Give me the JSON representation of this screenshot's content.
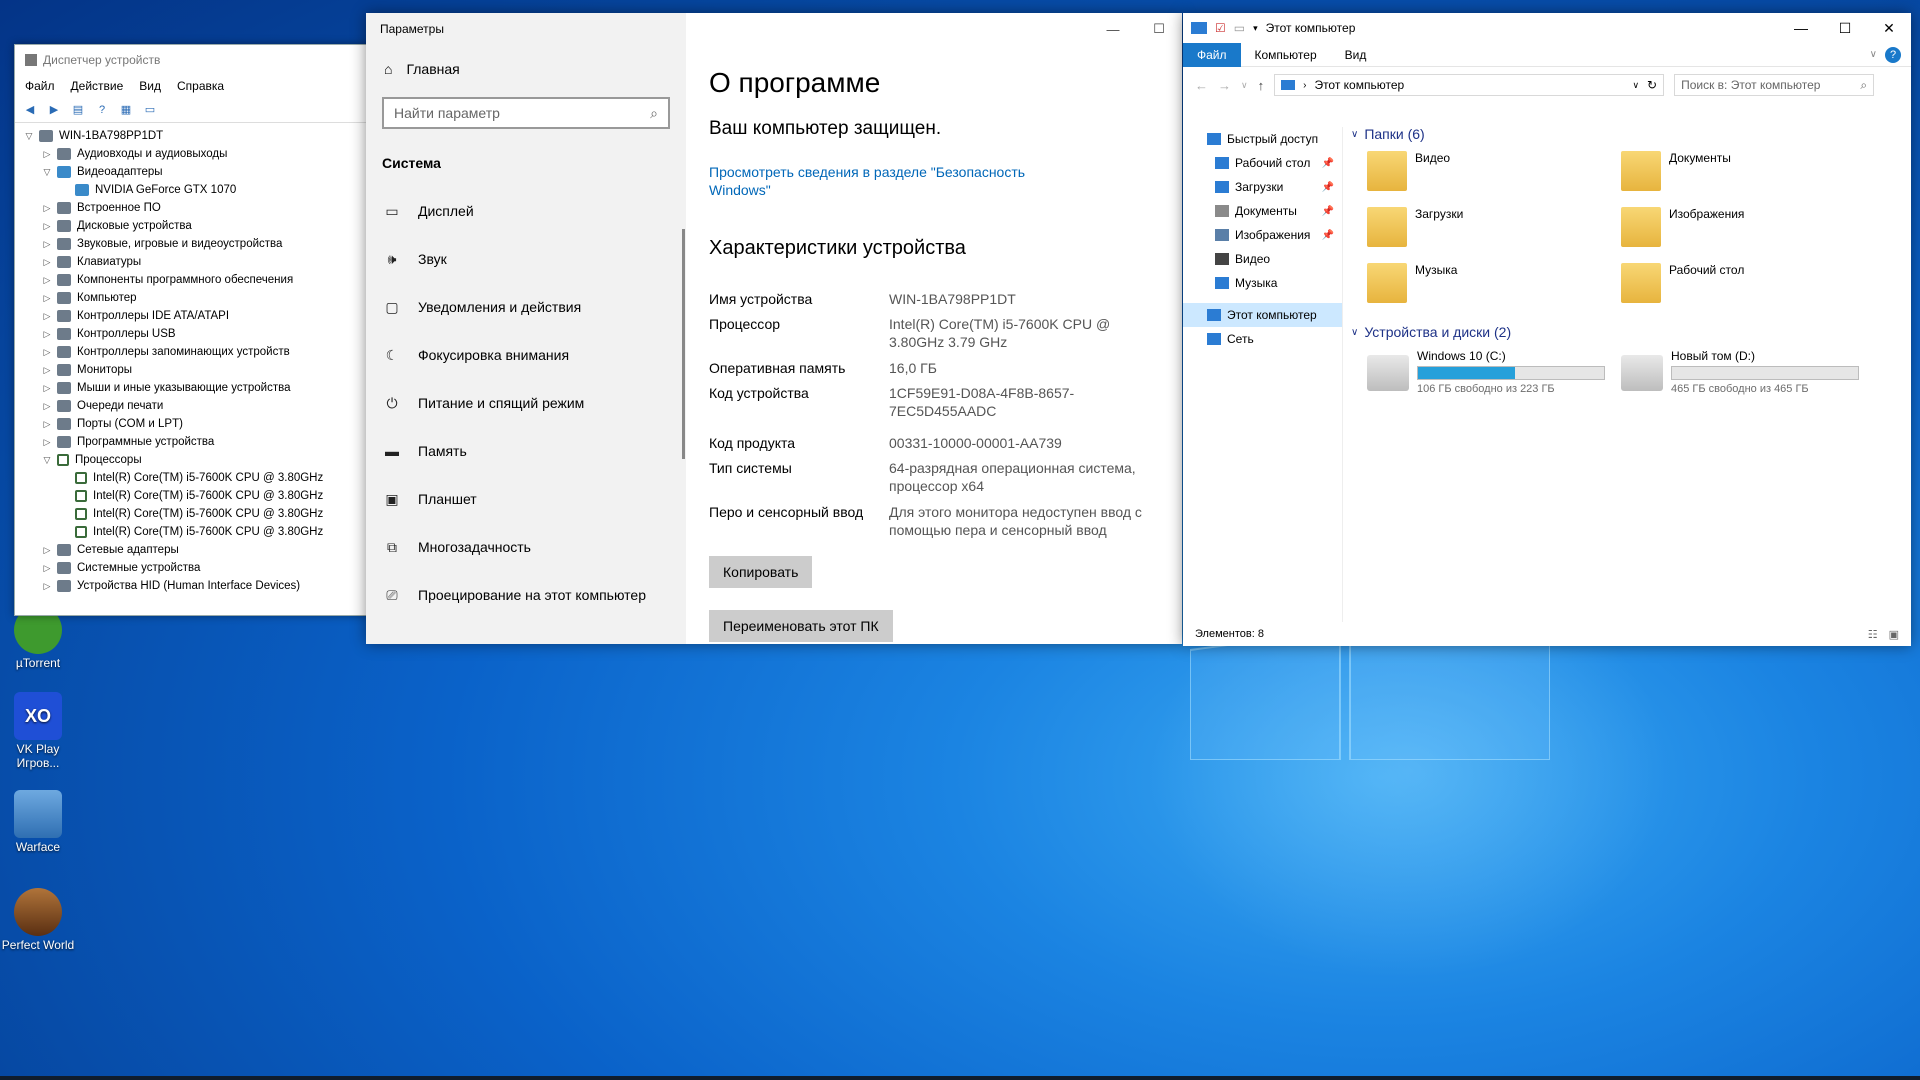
{
  "desktop": {
    "icons": [
      {
        "label": "µTorrent"
      },
      {
        "label": "VK Play Игров..."
      },
      {
        "label": "Warface"
      },
      {
        "label": "Perfect World"
      }
    ]
  },
  "device_manager": {
    "title": "Диспетчер устройств",
    "menu": [
      "Файл",
      "Действие",
      "Вид",
      "Справка"
    ],
    "tree": [
      {
        "label": "WIN-1BA798PP1DT",
        "level": 0,
        "expand": "down",
        "icon": "computer"
      },
      {
        "label": "Аудиовходы и аудиовыходы",
        "level": 1,
        "expand": "right",
        "icon": "audio"
      },
      {
        "label": "Видеоадаптеры",
        "level": 1,
        "expand": "down",
        "icon": "display"
      },
      {
        "label": "NVIDIA GeForce GTX 1070",
        "level": 2,
        "expand": "",
        "icon": "gpu"
      },
      {
        "label": "Встроенное ПО",
        "level": 1,
        "expand": "right",
        "icon": "firmware"
      },
      {
        "label": "Дисковые устройства",
        "level": 1,
        "expand": "right",
        "icon": "disk"
      },
      {
        "label": "Звуковые, игровые и видеоустройства",
        "level": 1,
        "expand": "right",
        "icon": "sound"
      },
      {
        "label": "Клавиатуры",
        "level": 1,
        "expand": "right",
        "icon": "keyboard"
      },
      {
        "label": "Компоненты программного обеспечения",
        "level": 1,
        "expand": "right",
        "icon": "software"
      },
      {
        "label": "Компьютер",
        "level": 1,
        "expand": "right",
        "icon": "computer"
      },
      {
        "label": "Контроллеры IDE ATA/ATAPI",
        "level": 1,
        "expand": "right",
        "icon": "ide"
      },
      {
        "label": "Контроллеры USB",
        "level": 1,
        "expand": "right",
        "icon": "usb"
      },
      {
        "label": "Контроллеры запоминающих устройств",
        "level": 1,
        "expand": "right",
        "icon": "storage"
      },
      {
        "label": "Мониторы",
        "level": 1,
        "expand": "right",
        "icon": "monitor"
      },
      {
        "label": "Мыши и иные указывающие устройства",
        "level": 1,
        "expand": "right",
        "icon": "mouse"
      },
      {
        "label": "Очереди печати",
        "level": 1,
        "expand": "right",
        "icon": "printer"
      },
      {
        "label": "Порты (COM и LPT)",
        "level": 1,
        "expand": "right",
        "icon": "port"
      },
      {
        "label": "Программные устройства",
        "level": 1,
        "expand": "right",
        "icon": "software-device"
      },
      {
        "label": "Процессоры",
        "level": 1,
        "expand": "down",
        "icon": "cpu"
      },
      {
        "label": "Intel(R) Core(TM) i5-7600K CPU @ 3.80GHz",
        "level": 2,
        "expand": "",
        "icon": "cpu"
      },
      {
        "label": "Intel(R) Core(TM) i5-7600K CPU @ 3.80GHz",
        "level": 2,
        "expand": "",
        "icon": "cpu"
      },
      {
        "label": "Intel(R) Core(TM) i5-7600K CPU @ 3.80GHz",
        "level": 2,
        "expand": "",
        "icon": "cpu"
      },
      {
        "label": "Intel(R) Core(TM) i5-7600K CPU @ 3.80GHz",
        "level": 2,
        "expand": "",
        "icon": "cpu"
      },
      {
        "label": "Сетевые адаптеры",
        "level": 1,
        "expand": "right",
        "icon": "network"
      },
      {
        "label": "Системные устройства",
        "level": 1,
        "expand": "right",
        "icon": "system"
      },
      {
        "label": "Устройства HID (Human Interface Devices)",
        "level": 1,
        "expand": "right",
        "icon": "hid"
      }
    ]
  },
  "settings": {
    "window_title": "Параметры",
    "home_label": "Главная",
    "search_placeholder": "Найти параметр",
    "section_label": "Система",
    "nav": [
      {
        "label": "Дисплей",
        "icon": "display-icon",
        "glyph": "▭"
      },
      {
        "label": "Звук",
        "icon": "speaker-icon",
        "glyph": "🕪"
      },
      {
        "label": "Уведомления и действия",
        "icon": "notification-icon",
        "glyph": "▢"
      },
      {
        "label": "Фокусировка внимания",
        "icon": "moon-icon",
        "glyph": "☾"
      },
      {
        "label": "Питание и спящий режим",
        "icon": "power-icon",
        "glyph": "⏻"
      },
      {
        "label": "Память",
        "icon": "storage-icon",
        "glyph": "▬"
      },
      {
        "label": "Планшет",
        "icon": "tablet-icon",
        "glyph": "▣"
      },
      {
        "label": "Многозадачность",
        "icon": "multitask-icon",
        "glyph": "⧉"
      },
      {
        "label": "Проецирование на этот компьютер",
        "icon": "project-icon",
        "glyph": "⎚"
      }
    ],
    "about": {
      "title": "О программе",
      "protection": "Ваш компьютер защищен.",
      "security_link": "Просмотреть сведения в разделе \"Безопасность Windows\"",
      "specs_title": "Характеристики устройства",
      "specs": [
        {
          "key": "Имя устройства",
          "value": "WIN-1BA798PP1DT"
        },
        {
          "key": "Процессор",
          "value": "Intel(R) Core(TM) i5-7600K CPU @ 3.80GHz 3.79 GHz"
        },
        {
          "key": "Оперативная память",
          "value": "16,0 ГБ"
        },
        {
          "key": "Код устройства",
          "value": "1CF59E91-D08A-4F8B-8657-7EC5D455AADC"
        },
        {
          "key": "Код продукта",
          "value": "00331-10000-00001-AA739"
        },
        {
          "key": "Тип системы",
          "value": "64-разрядная операционная система, процессор x64"
        },
        {
          "key": "Перо и сенсорный ввод",
          "value": "Для этого монитора недоступен ввод с помощью пера и сенсорный ввод"
        }
      ],
      "copy_button": "Копировать",
      "rename_button": "Переименовать этот ПК"
    }
  },
  "explorer": {
    "title": "Этот компьютер",
    "ribbon_tabs": [
      "Файл",
      "Компьютер",
      "Вид"
    ],
    "address": "Этот компьютер",
    "search_placeholder": "Поиск в: Этот компьютер",
    "nav": [
      {
        "label": "Быстрый доступ",
        "level": 0,
        "pin": false,
        "color": "#2b7cd3"
      },
      {
        "label": "Рабочий стол",
        "level": 1,
        "pin": true,
        "color": "#2b7cd3"
      },
      {
        "label": "Загрузки",
        "level": 1,
        "pin": true,
        "color": "#2b7cd3"
      },
      {
        "label": "Документы",
        "level": 1,
        "pin": true,
        "color": "#8a8a8a"
      },
      {
        "label": "Изображения",
        "level": 1,
        "pin": true,
        "color": "#5a7fa8"
      },
      {
        "label": "Видео",
        "level": 1,
        "pin": false,
        "color": "#444"
      },
      {
        "label": "Музыка",
        "level": 1,
        "pin": false,
        "color": "#2b7cd3"
      },
      {
        "label": "Этот компьютер",
        "level": 0,
        "pin": false,
        "color": "#2b7cd3",
        "selected": true
      },
      {
        "label": "Сеть",
        "level": 0,
        "pin": false,
        "color": "#2b7cd3"
      }
    ],
    "folders_header": "Папки (6)",
    "folders": [
      "Видео",
      "Документы",
      "Загрузки",
      "Изображения",
      "Музыка",
      "Рабочий стол"
    ],
    "drives_header": "Устройства и диски (2)",
    "drives": [
      {
        "name": "Windows 10 (C:)",
        "free": "106 ГБ свободно из 223 ГБ",
        "used_fraction": 0.52
      },
      {
        "name": "Новый том (D:)",
        "free": "465 ГБ свободно из 465 ГБ",
        "used_fraction": 0.0
      }
    ],
    "status": "Элементов: 8"
  },
  "colors": {
    "accent": "#1979ca",
    "link": "#0067b8",
    "drive_fill": "#26a0da"
  }
}
